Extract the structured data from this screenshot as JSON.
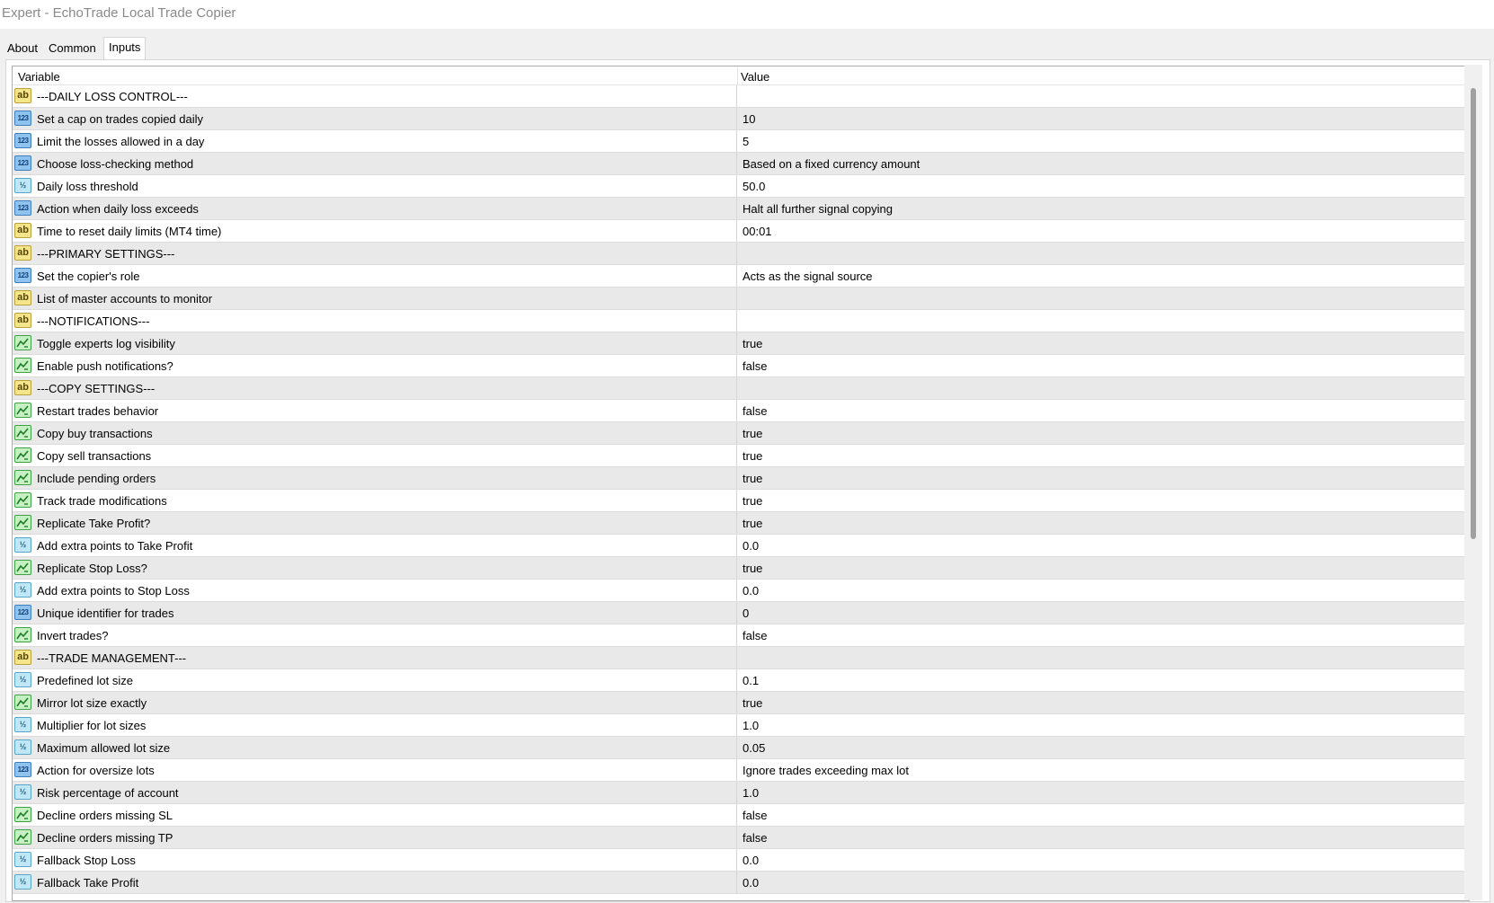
{
  "window": {
    "title": "Expert - EchoTrade Local Trade Copier"
  },
  "tabs": [
    {
      "label": "About"
    },
    {
      "label": "Common"
    },
    {
      "label": "Inputs"
    }
  ],
  "table": {
    "headers": {
      "variable": "Variable",
      "value": "Value"
    },
    "rows": [
      {
        "icon": "ab",
        "variable": "---DAILY LOSS CONTROL---",
        "value": ""
      },
      {
        "icon": "int",
        "variable": "Set a cap on trades copied daily",
        "value": "10"
      },
      {
        "icon": "int",
        "variable": "Limit the losses allowed in a day",
        "value": "5"
      },
      {
        "icon": "int",
        "variable": "Choose loss-checking method",
        "value": "Based on a fixed currency amount"
      },
      {
        "icon": "dbl",
        "variable": "Daily loss threshold",
        "value": "50.0"
      },
      {
        "icon": "int",
        "variable": "Action when daily loss exceeds",
        "value": "Halt all further signal copying"
      },
      {
        "icon": "ab",
        "variable": "Time to reset daily limits (MT4 time)",
        "value": "00:01"
      },
      {
        "icon": "ab",
        "variable": "---PRIMARY SETTINGS---",
        "value": ""
      },
      {
        "icon": "int",
        "variable": "Set the copier's role",
        "value": "Acts as the signal source"
      },
      {
        "icon": "ab",
        "variable": "List of master accounts to monitor",
        "value": ""
      },
      {
        "icon": "ab",
        "variable": "---NOTIFICATIONS---",
        "value": ""
      },
      {
        "icon": "bool",
        "variable": "Toggle experts log visibility",
        "value": "true"
      },
      {
        "icon": "bool",
        "variable": "Enable push notifications?",
        "value": "false"
      },
      {
        "icon": "ab",
        "variable": "---COPY SETTINGS---",
        "value": ""
      },
      {
        "icon": "bool",
        "variable": "Restart trades behavior",
        "value": "false"
      },
      {
        "icon": "bool",
        "variable": "Copy buy transactions",
        "value": "true"
      },
      {
        "icon": "bool",
        "variable": "Copy sell transactions",
        "value": "true"
      },
      {
        "icon": "bool",
        "variable": "Include pending orders",
        "value": "true"
      },
      {
        "icon": "bool",
        "variable": "Track trade modifications",
        "value": "true"
      },
      {
        "icon": "bool",
        "variable": "Replicate Take Profit?",
        "value": "true"
      },
      {
        "icon": "dbl",
        "variable": "Add extra points to Take Profit",
        "value": "0.0"
      },
      {
        "icon": "bool",
        "variable": "Replicate Stop Loss?",
        "value": "true"
      },
      {
        "icon": "dbl",
        "variable": "Add extra points to Stop Loss",
        "value": "0.0"
      },
      {
        "icon": "int",
        "variable": "Unique identifier for trades",
        "value": "0"
      },
      {
        "icon": "bool",
        "variable": "Invert trades?",
        "value": "false"
      },
      {
        "icon": "ab",
        "variable": "---TRADE MANAGEMENT---",
        "value": ""
      },
      {
        "icon": "dbl",
        "variable": "Predefined lot size",
        "value": "0.1"
      },
      {
        "icon": "bool",
        "variable": "Mirror lot size exactly",
        "value": "true"
      },
      {
        "icon": "dbl",
        "variable": "Multiplier for lot sizes",
        "value": "1.0"
      },
      {
        "icon": "dbl",
        "variable": "Maximum allowed lot size",
        "value": "0.05"
      },
      {
        "icon": "int",
        "variable": "Action for oversize lots",
        "value": "Ignore trades exceeding max lot"
      },
      {
        "icon": "dbl",
        "variable": "Risk percentage of account",
        "value": "1.0"
      },
      {
        "icon": "bool",
        "variable": "Decline orders missing SL",
        "value": "false"
      },
      {
        "icon": "bool",
        "variable": "Decline orders missing TP",
        "value": "false"
      },
      {
        "icon": "dbl",
        "variable": "Fallback Stop Loss",
        "value": "0.0"
      },
      {
        "icon": "dbl",
        "variable": "Fallback Take Profit",
        "value": "0.0"
      }
    ]
  },
  "icon_names": {
    "ab": "string-type-icon",
    "int": "integer-type-icon",
    "dbl": "double-type-icon",
    "bool": "boolean-type-icon"
  },
  "icon_glyphs": {
    "ab": "ab",
    "int": "123",
    "dbl": "½"
  },
  "colors": {
    "row_alt": "#e9e9e9",
    "row_base": "#ffffff",
    "title_text": "#8a8a8a"
  }
}
